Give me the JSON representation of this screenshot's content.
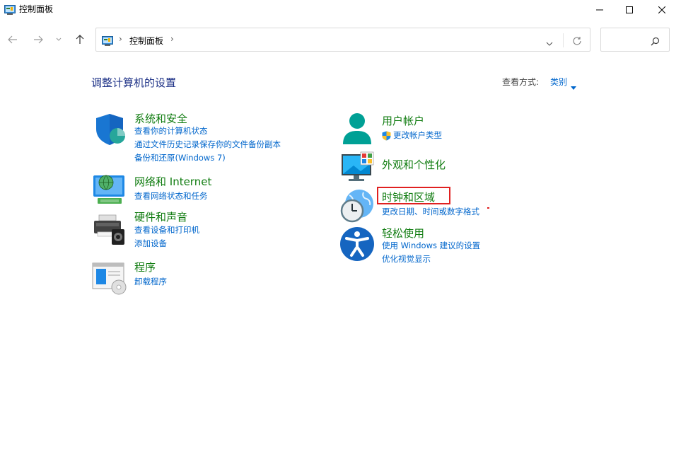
{
  "window": {
    "title": "控制面板"
  },
  "address": {
    "path_item": "控制面板",
    "separator": "›"
  },
  "search": {
    "placeholder": ""
  },
  "main": {
    "heading": "调整计算机的设置",
    "view_by_label": "查看方式:",
    "view_by_value": "类别"
  },
  "categories": {
    "system_security": {
      "title": "系统和安全",
      "links": [
        "查看你的计算机状态",
        "通过文件历史记录保存你的文件备份副本",
        "备份和还原(Windows 7)"
      ]
    },
    "network": {
      "title": "网络和 Internet",
      "links": [
        "查看网络状态和任务"
      ]
    },
    "hardware": {
      "title": "硬件和声音",
      "links": [
        "查看设备和打印机",
        "添加设备"
      ]
    },
    "programs": {
      "title": "程序",
      "links": [
        "卸载程序"
      ]
    },
    "user_accounts": {
      "title": "用户帐户",
      "links": [
        "更改帐户类型"
      ]
    },
    "appearance": {
      "title": "外观和个性化",
      "links": []
    },
    "clock_region": {
      "title": "时钟和区域",
      "links": [
        "更改日期、时间或数字格式"
      ]
    },
    "ease_of_access": {
      "title": "轻松使用",
      "links": [
        "使用 Windows 建议的设置",
        "优化视觉显示"
      ]
    }
  },
  "colors": {
    "category_title": "#107c10",
    "link": "#0066cc",
    "heading": "#1e3287",
    "highlight": "#e02020"
  }
}
